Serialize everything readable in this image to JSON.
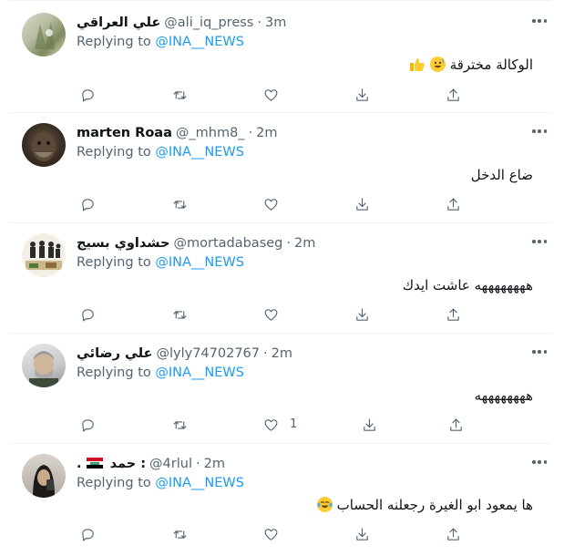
{
  "replying_label": "Replying to",
  "tweets": [
    {
      "name": "علي العراقي",
      "handle": "@ali_iq_press",
      "dot": "·",
      "time": "3m",
      "mention": "@INA__NEWS",
      "text": "الوكالة مخترقة",
      "emoji": [
        "grinning-sweat-face-emoji",
        "thumbs-up-emoji"
      ],
      "like_count": ""
    },
    {
      "name": "marten Roaa",
      "handle": "@_mhm8_",
      "dot": "·",
      "time": "2m",
      "mention": "@INA__NEWS",
      "text": "ضاع الدخل",
      "like_count": ""
    },
    {
      "name": "حشداوي بسيج",
      "handle": "@mortadabaseg",
      "dot": "·",
      "time": "2m",
      "mention": "@INA__NEWS",
      "text": "ههههههههه عاشت ايدك",
      "like_count": ""
    },
    {
      "name": "علي رضائي",
      "handle": "@lyly74702767",
      "dot": "·",
      "time": "2m",
      "mention": "@INA__NEWS",
      "text": "ههههههههه",
      "like_count": "1"
    },
    {
      "name": "حمد :",
      "name_suffix": ".",
      "handle": "@4rlul",
      "dot": "·",
      "time": "2m",
      "mention": "@INA__NEWS",
      "text": "ها يمعود ابو الغيرة رجعلنه الحساب",
      "emoji": [
        "face-with-tears-of-joy-emoji"
      ],
      "like_count": ""
    }
  ],
  "icons": [
    "reply-icon",
    "retweet-icon",
    "like-icon",
    "download-icon",
    "share-icon",
    "more-icon"
  ]
}
